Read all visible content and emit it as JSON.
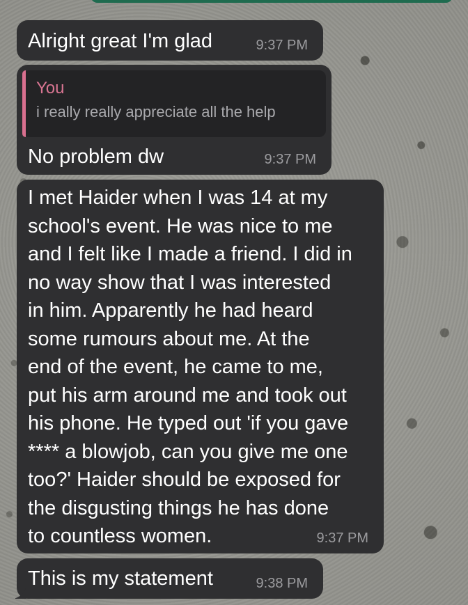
{
  "messages": [
    {
      "text": "Alright great I'm glad",
      "time": "9:37 PM"
    },
    {
      "quote": {
        "author": "You",
        "text": "i really really appreciate all the help"
      },
      "text": "No problem dw",
      "time": "9:37 PM"
    },
    {
      "text": "I met Haider when I was 14 at my\nschool's event. He was nice to me\nand I felt like I made a friend. I did in\nno way show that I was interested\nin him. Apparently he had heard\nsome rumours about me. At the\nend of the event, he came to me,\nput his arm around me and took out\nhis phone. He typed out 'if you gave\n**** a blowjob, can you give me one\ntoo?' Haider should be exposed for\nthe disgusting things he has done\nto countless women.",
      "time": "9:37 PM"
    },
    {
      "text": "This is my statement",
      "time": "9:38 PM"
    }
  ],
  "colors": {
    "bubble": "#2f2f31",
    "quote_bar": "#d9708f",
    "quote_author": "#d87592",
    "timestamp": "#9c9c9f",
    "header_strip": "#1f6b4f"
  }
}
